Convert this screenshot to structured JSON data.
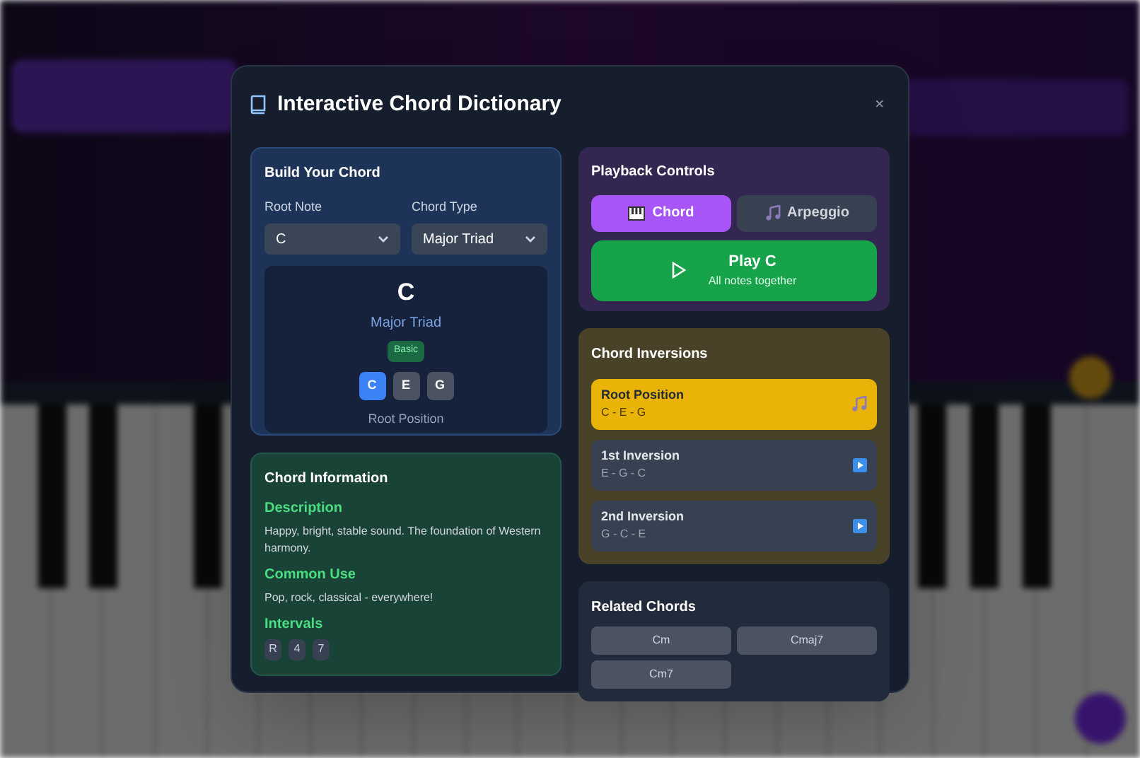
{
  "dialog": {
    "title": "Interactive Chord Dictionary",
    "close": "×"
  },
  "builder": {
    "title": "Build Your Chord",
    "root_note": {
      "label": "Root Note",
      "value": "C"
    },
    "chord_type": {
      "label": "Chord Type",
      "value": "Major Triad"
    },
    "preview": {
      "symbol": "C",
      "name": "Major Triad",
      "badge": "Basic",
      "position": "Root Position",
      "notes": [
        {
          "label": "C",
          "selected": true
        },
        {
          "label": "E",
          "selected": false
        },
        {
          "label": "G",
          "selected": false
        }
      ]
    }
  },
  "info": {
    "title": "Chord Information",
    "sections": [
      {
        "heading": "Description",
        "text": "Happy, bright, stable sound. The foundation of Western harmony."
      },
      {
        "heading": "Common Use",
        "text": "Pop, rock, classical - everywhere!"
      }
    ],
    "intervals": {
      "heading": "Intervals",
      "items": [
        "R",
        "4",
        "7"
      ]
    }
  },
  "playback": {
    "title": "Playback Controls",
    "modes": [
      {
        "label": "Chord",
        "selected": true,
        "kind": "piano"
      },
      {
        "label": "Arpeggio",
        "selected": false,
        "kind": "note"
      }
    ],
    "play": {
      "label": "Play C",
      "sublabel": "All notes together"
    }
  },
  "inversions": {
    "title": "Chord Inversions",
    "items": [
      {
        "name": "Root Position",
        "notes": "C - E - G",
        "selected": true
      },
      {
        "name": "1st Inversion",
        "notes": "E - G - C",
        "selected": false
      },
      {
        "name": "2nd Inversion",
        "notes": "G - C - E",
        "selected": false
      }
    ]
  },
  "related": {
    "title": "Related Chords",
    "items": [
      "Cm",
      "Cmaj7",
      "Cm7"
    ]
  }
}
